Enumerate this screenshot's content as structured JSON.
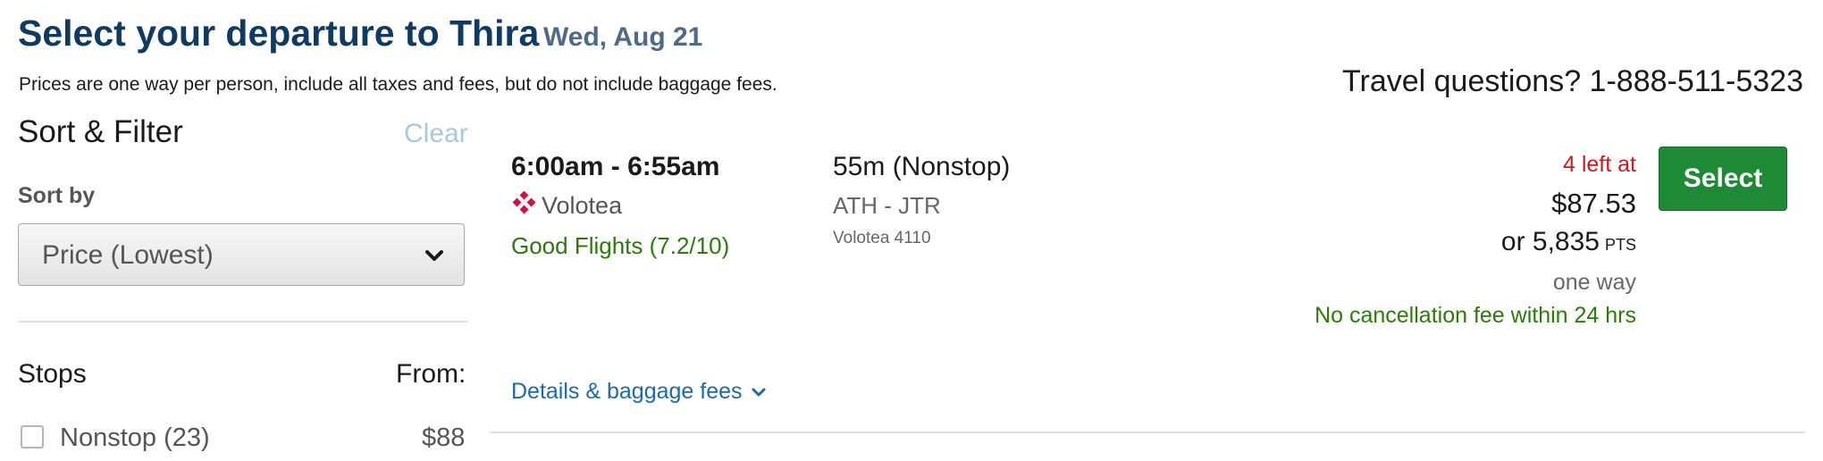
{
  "header": {
    "title": "Select your departure to Thira",
    "date": "Wed, Aug 21",
    "disclaimer": "Prices are one way per person, include all taxes and fees, but do not include baggage fees.",
    "travel_questions": "Travel questions? 1-888-511-5323"
  },
  "sidebar": {
    "title": "Sort & Filter",
    "clear_label": "Clear",
    "sort_by_label": "Sort by",
    "sort_value": "Price (Lowest)",
    "stops_label": "Stops",
    "from_label": "From:",
    "stop_options": [
      {
        "label": "Nonstop (23)",
        "price": "$88",
        "checked": false
      }
    ]
  },
  "flight": {
    "times": "6:00am - 6:55am",
    "airline": "Volotea",
    "airline_icon": "volotea-logo-icon",
    "rating": "Good Flights (7.2/10)",
    "duration": "55m (Nonstop)",
    "route": "ATH - JTR",
    "flight_number": "Volotea 4110",
    "seats_left": "4 left at",
    "price": "$87.53",
    "points": "or 5,835",
    "points_unit": "PTS",
    "fare_type": "one way",
    "cancellation": "No cancellation fee within 24 hrs",
    "select_label": "Select",
    "details_label": "Details & baggage fees"
  },
  "colors": {
    "title": "#0f3a63",
    "accent_green": "#1f8a35",
    "link_blue": "#1b6ab0",
    "alert_red": "#d1181d",
    "logo_red": "#d3123e"
  }
}
